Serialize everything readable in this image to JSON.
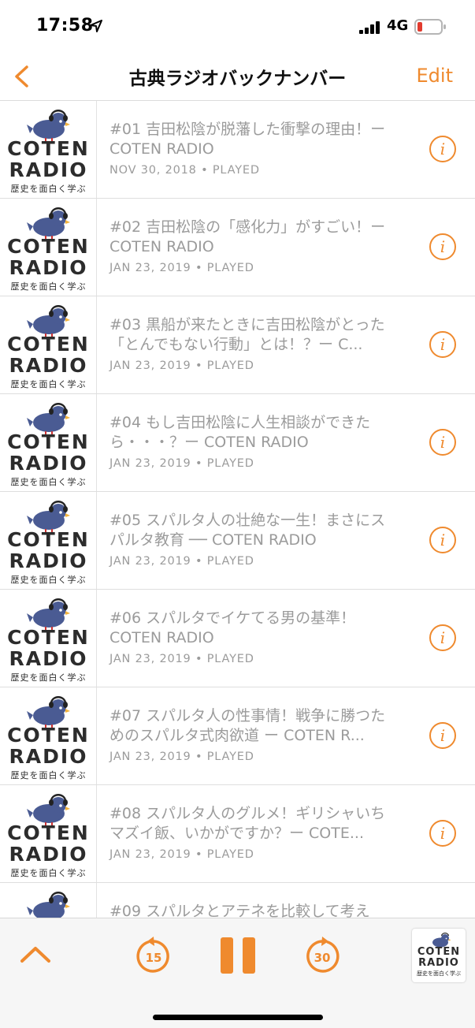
{
  "status_bar": {
    "time": "17:58",
    "network": "4G"
  },
  "nav": {
    "title": "古典ラジオバックナンバー",
    "edit_label": "Edit"
  },
  "artwork": {
    "line1": "COTEN",
    "line2": "RADIO",
    "line3": "歴史を面白く学ぶ"
  },
  "episodes": [
    {
      "title": "#01 吉田松陰が脱藩した衝撃の理由！ー COTEN RADIO",
      "meta": "NOV 30, 2018 • PLAYED"
    },
    {
      "title": "#02 吉田松陰の「感化力」がすごい！ー COTEN RADIO",
      "meta": "JAN 23, 2019 • PLAYED"
    },
    {
      "title": "#03 黒船が来たときに吉田松陰がとった「とんでもない行動」とは！？ー C...",
      "meta": "JAN 23, 2019 • PLAYED"
    },
    {
      "title": "#04 もし吉田松陰に人生相談ができたら・・・？ー COTEN RADIO",
      "meta": "JAN 23, 2019 • PLAYED"
    },
    {
      "title": "#05 スパルタ人の壮絶な一生！まさにスパルタ教育 ── COTEN RADIO",
      "meta": "JAN 23, 2019 • PLAYED"
    },
    {
      "title": "#06 スパルタでイケてる男の基準！COTEN RADIO",
      "meta": "JAN 23, 2019 • PLAYED"
    },
    {
      "title": "#07 スパルタ人の性事情！戦争に勝つためのスパルタ式肉欲道 ー COTEN R...",
      "meta": "JAN 23, 2019 • PLAYED"
    },
    {
      "title": "#08 スパルタ人のグルメ！ギリシャいちマズイ飯、いかがですか？ー COTE...",
      "meta": "JAN 23, 2019 • PLAYED"
    },
    {
      "title": "#09 スパルタとアテネを比較して考え",
      "meta": ""
    }
  ],
  "player": {
    "skip_back": "15",
    "skip_forward": "30",
    "state": "playing"
  },
  "icons": {
    "back": "chevron-left-icon",
    "info": "info-icon",
    "expand": "chevron-up-icon",
    "pause": "pause-icon"
  },
  "colors": {
    "accent": "#ef8a2e",
    "muted_text": "#9b9b9b",
    "battery_low": "#e23b2e",
    "logo_bird": "#4a5b93"
  }
}
